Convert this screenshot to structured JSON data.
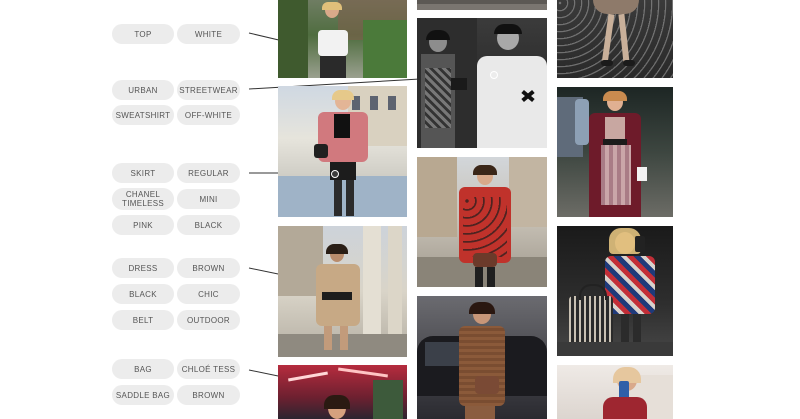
{
  "tag_groups": [
    {
      "tags": [
        "TOP",
        "WHITE"
      ]
    },
    {
      "tags": [
        "URBAN",
        "STREETWEAR",
        "SWEATSHIRT",
        "OFF-WHITE"
      ]
    },
    {
      "tags": [
        "SKIRT",
        "REGULAR",
        "CHANEL TIMELESS",
        "MINI",
        "PINK",
        "BLACK"
      ]
    },
    {
      "tags": [
        "DRESS",
        "BROWN",
        "BLACK",
        "CHIC",
        "BELT",
        "OUTDOOR"
      ]
    },
    {
      "tags": [
        "BAG",
        "CHLOÉ TESS",
        "SADDLE BAG",
        "BROWN"
      ]
    }
  ],
  "colors": {
    "tag_background": "#ececec",
    "tag_text": "#555555",
    "connector_line": "#333333"
  },
  "photos": [
    {
      "id": "white-top-photo",
      "scene": "street-greenery"
    },
    {
      "id": "pink-jacket-photo",
      "scene": "paris-building"
    },
    {
      "id": "beige-dress-photo",
      "scene": "columns"
    },
    {
      "id": "red-light-photo",
      "scene": "red-lights"
    },
    {
      "id": "partial-top-photo",
      "scene": "pavement"
    },
    {
      "id": "bw-streetwear-photo",
      "scene": "black-and-white"
    },
    {
      "id": "red-coat-photo",
      "scene": "courtyard"
    },
    {
      "id": "brown-knit-photo",
      "scene": "car"
    },
    {
      "id": "sequin-legs-photo",
      "scene": "dark-sequin"
    },
    {
      "id": "burgundy-coat-photo",
      "scene": "street"
    },
    {
      "id": "black-bag-photo",
      "scene": "dark-street"
    },
    {
      "id": "phone-selfie-photo",
      "scene": "light-interior"
    }
  ]
}
